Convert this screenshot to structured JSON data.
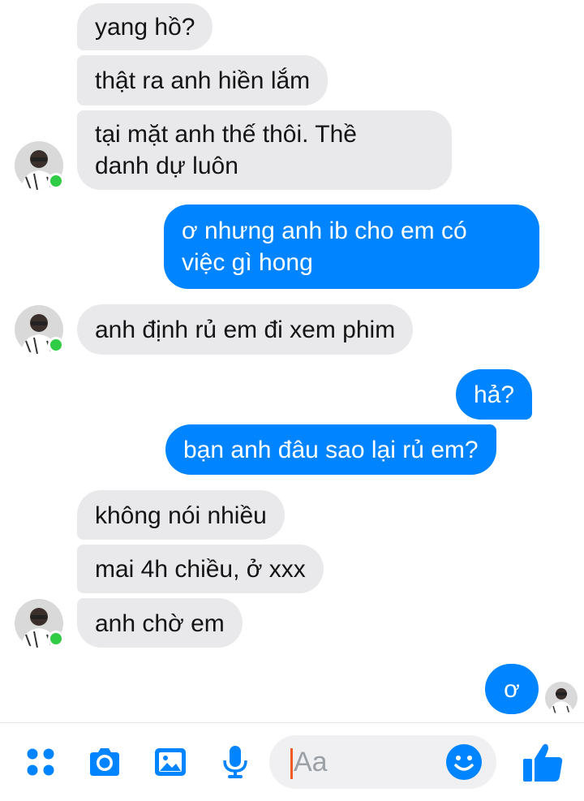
{
  "conversation": {
    "messages": [
      {
        "side": "received",
        "text": "yang hồ?"
      },
      {
        "side": "received",
        "text": "thật ra anh hiền lắm"
      },
      {
        "side": "received",
        "text": "tại mặt anh thế thôi. Thề\ndanh dự luôn"
      },
      {
        "side": "sent",
        "text": "ơ nhưng anh ib cho em có\nviệc gì hong"
      },
      {
        "side": "received",
        "text": "anh định rủ em đi xem phim"
      },
      {
        "side": "sent",
        "text": "hả?"
      },
      {
        "side": "sent",
        "text": "bạn anh đâu sao lại rủ em?"
      },
      {
        "side": "received",
        "text": "không nói nhiều"
      },
      {
        "side": "received",
        "text": "mai 4h chiều, ở xxx"
      },
      {
        "side": "received",
        "text": "anh chờ em"
      },
      {
        "side": "sent",
        "text": "ơ"
      }
    ],
    "contact_online": true
  },
  "composer": {
    "placeholder": "Aa",
    "icons": [
      "apps-icon",
      "camera-icon",
      "image-icon",
      "microphone-icon",
      "emoji-icon",
      "thumbs-up-icon"
    ]
  },
  "colors": {
    "sent_bubble": "#0084ff",
    "received_bubble": "#e9e9eb",
    "online": "#31cc46",
    "accent": "#0084ff"
  }
}
